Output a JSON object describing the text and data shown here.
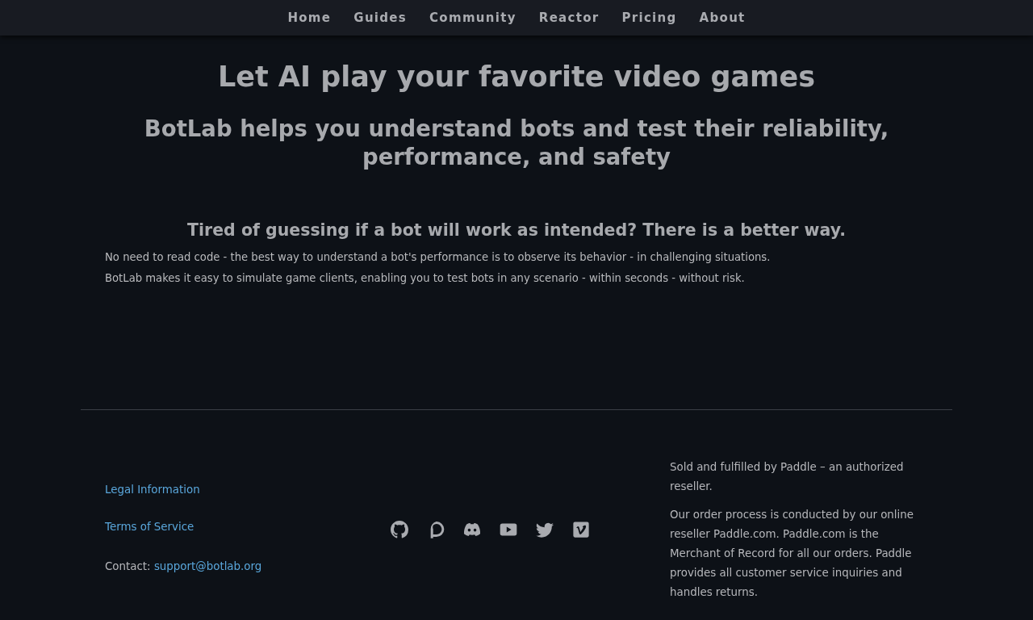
{
  "nav": [
    "Home",
    "Guides",
    "Community",
    "Reactor",
    "Pricing",
    "About"
  ],
  "hero": {
    "title": "Let AI play your favorite video games",
    "subtitle": "BotLab helps you understand bots and test their reliability, performance, and safety"
  },
  "intro": {
    "heading": "Tired of guessing if a bot will work as intended? There is a better way.",
    "paragraphs": [
      "No need to read code - the best way to understand a bot's performance is to observe its behavior - in challenging situations.",
      "BotLab makes it easy to simulate game clients, enabling you to test bots in any scenario - within seconds - without risk."
    ]
  },
  "footer": {
    "links": [
      "Legal Information",
      "Terms of Service"
    ],
    "contact": {
      "label": "Contact:",
      "email": "support@botlab.org"
    },
    "seller_notes": [
      "Sold and fulfilled by Paddle – an authorized reseller.",
      "Our order process is conducted by our online reseller Paddle.com. Paddle.com is the Merchant of Record for all our orders. Paddle provides all customer service inquiries and handles returns."
    ]
  }
}
